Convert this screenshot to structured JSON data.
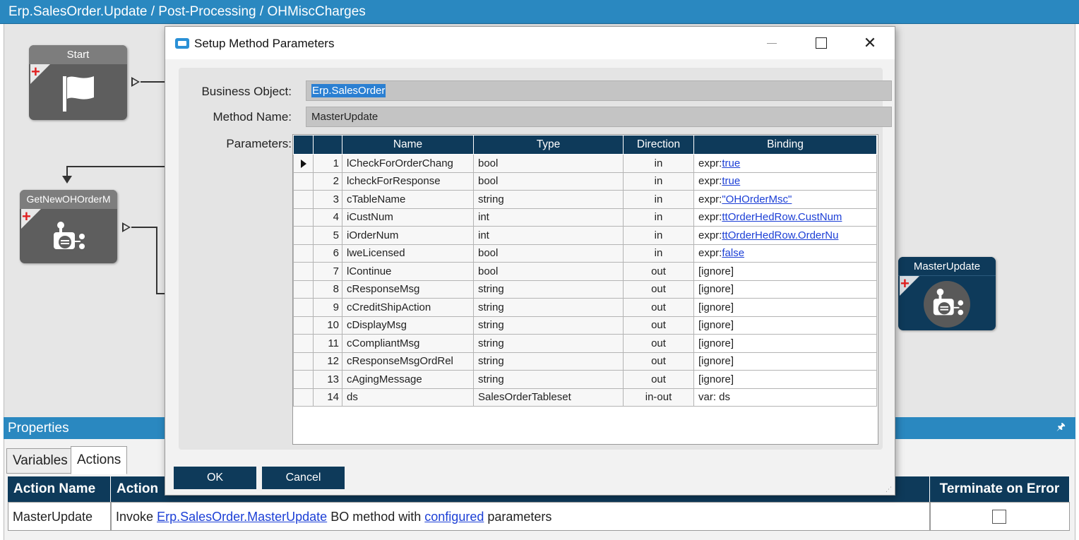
{
  "window_title": "Erp.SalesOrder.Update / Post-Processing / OHMiscCharges",
  "nodes": {
    "start": "Start",
    "get_new": "GetNewOHOrderM",
    "master_update": "MasterUpdate"
  },
  "properties": {
    "title": "Properties",
    "tabs": [
      "Variables",
      "Actions"
    ],
    "active_tab": "Actions",
    "columns": {
      "action_name": "Action Name",
      "action": "Action",
      "terminate": "Terminate on Error"
    },
    "row": {
      "action_name": "MasterUpdate",
      "invoke": "Invoke",
      "method_link": "Erp.SalesOrder.MasterUpdate",
      "bo_method_with": "BO method with",
      "configured_link": "configured",
      "parameters": "parameters",
      "terminate_checked": false
    }
  },
  "dialog": {
    "title": "Setup Method Parameters",
    "business_object_label": "Business Object:",
    "business_object_value": "Erp.SalesOrder",
    "method_name_label": "Method Name:",
    "method_name_value": "MasterUpdate",
    "parameters_label": "Parameters:",
    "columns": [
      "Name",
      "Type",
      "Direction",
      "Binding"
    ],
    "rows": [
      {
        "n": "1",
        "name": "lCheckForOrderChang",
        "type": "bool",
        "dir": "in",
        "prefix": "expr:",
        "link": "true",
        "current": true
      },
      {
        "n": "2",
        "name": "lcheckForResponse",
        "type": "bool",
        "dir": "in",
        "prefix": "expr:",
        "link": "true"
      },
      {
        "n": "3",
        "name": "cTableName",
        "type": "string",
        "dir": "in",
        "prefix": "expr:",
        "link": "\"OHOrderMsc\""
      },
      {
        "n": "4",
        "name": "iCustNum",
        "type": "int",
        "dir": "in",
        "prefix": "expr:",
        "link": "ttOrderHedRow.CustNum"
      },
      {
        "n": "5",
        "name": "iOrderNum",
        "type": "int",
        "dir": "in",
        "prefix": "expr:",
        "link": "ttOrderHedRow.OrderNu"
      },
      {
        "n": "6",
        "name": "lweLicensed",
        "type": "bool",
        "dir": "in",
        "prefix": "expr:",
        "link": "false"
      },
      {
        "n": "7",
        "name": "lContinue",
        "type": "bool",
        "dir": "out",
        "prefix": "[ignore]",
        "link": ""
      },
      {
        "n": "8",
        "name": "cResponseMsg",
        "type": "string",
        "dir": "out",
        "prefix": "[ignore]",
        "link": ""
      },
      {
        "n": "9",
        "name": "cCreditShipAction",
        "type": "string",
        "dir": "out",
        "prefix": "[ignore]",
        "link": ""
      },
      {
        "n": "10",
        "name": "cDisplayMsg",
        "type": "string",
        "dir": "out",
        "prefix": "[ignore]",
        "link": ""
      },
      {
        "n": "11",
        "name": "cCompliantMsg",
        "type": "string",
        "dir": "out",
        "prefix": "[ignore]",
        "link": ""
      },
      {
        "n": "12",
        "name": "cResponseMsgOrdRel",
        "type": "string",
        "dir": "out",
        "prefix": "[ignore]",
        "link": ""
      },
      {
        "n": "13",
        "name": "cAgingMessage",
        "type": "string",
        "dir": "out",
        "prefix": "[ignore]",
        "link": ""
      },
      {
        "n": "14",
        "name": "ds",
        "type": "SalesOrderTableset",
        "dir": "in-out",
        "prefix": "var: ds",
        "link": ""
      }
    ],
    "ok_label": "OK",
    "cancel_label": "Cancel"
  },
  "colors": {
    "header_blue": "#2a88c0",
    "navy": "#0e3a5a",
    "link": "#1c3fd6",
    "selection": "#2a7fd2"
  }
}
